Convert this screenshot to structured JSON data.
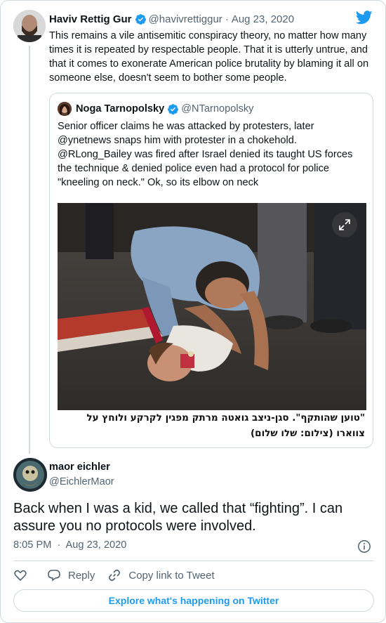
{
  "parent_tweet": {
    "name": "Haviv Rettig Gur",
    "handle": "@havivrettiggur",
    "separator": "·",
    "date": "Aug 23, 2020",
    "text": "This remains a vile antisemitic conspiracy theory, no matter how many times it is repeated by respectable people. That it is utterly untrue, and that it comes to exonerate American police brutality by blaming it all on someone else, doesn't seem to bother some people."
  },
  "quoted_tweet": {
    "name": "Noga Tarnopolsky",
    "handle": "@NTarnopolsky",
    "text": "Senior officer claims he was attacked by protesters, later @ynetnews snaps him with protester in a chokehold. @RLong_Bailey was fired after Israel denied its taught US forces the technique & denied police even had a protocol for police \"kneeling on neck.\" Ok, so its elbow on neck",
    "caption_line1": "\"טוען שהותקף\". סגן-ניצב גואטה מרתק מפגין לקרקע ולוחץ על",
    "caption_line2": "צווארו (צילום: שלו שלום)"
  },
  "reply_tweet": {
    "name": "maor eichler",
    "handle": "@EichlerMaor",
    "text": "Back when I was a kid, we called that “fighting”. I can assure you no protocols were involved.",
    "time": "8:05 PM",
    "separator": "·",
    "date": "Aug 23, 2020"
  },
  "actions": {
    "reply_label": "Reply",
    "copy_link_label": "Copy link to Tweet"
  },
  "footer": {
    "explore_label": "Explore what's happening on Twitter"
  },
  "colors": {
    "accent": "#1d9bf0",
    "secondary_text": "#536471",
    "border": "#cfd9de"
  },
  "icons": {
    "verified": "verified-badge-icon",
    "brand": "twitter-bird-icon",
    "expand": "expand-icon",
    "info": "info-icon",
    "like": "heart-icon",
    "reply": "reply-bubble-icon",
    "copy_link": "link-icon"
  }
}
